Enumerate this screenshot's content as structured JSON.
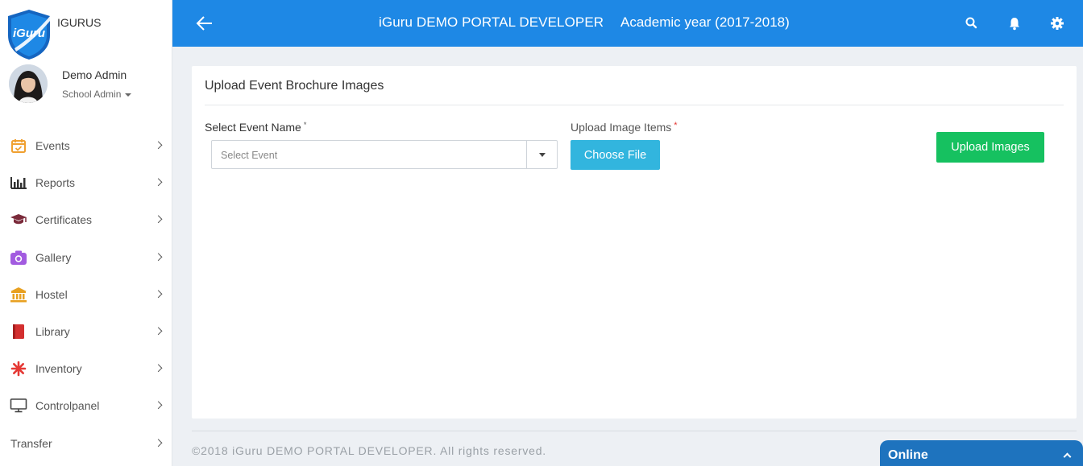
{
  "brand": {
    "name": "IGURUS",
    "logo_text": "iGuru"
  },
  "user": {
    "name": "Demo Admin",
    "role": "School Admin"
  },
  "nav": [
    {
      "label": "Events",
      "icon": "calendar-check-icon",
      "color": "#f0a030"
    },
    {
      "label": "Reports",
      "icon": "bar-chart-icon",
      "color": "#333333"
    },
    {
      "label": "Certificates",
      "icon": "graduation-cap-icon",
      "color": "#7a2a3a"
    },
    {
      "label": "Gallery",
      "icon": "camera-icon",
      "color": "#a25be0"
    },
    {
      "label": "Hostel",
      "icon": "building-icon",
      "color": "#e8a020"
    },
    {
      "label": "Library",
      "icon": "book-icon",
      "color": "#d32f2f"
    },
    {
      "label": "Inventory",
      "icon": "asterisk-icon",
      "color": "#e53935"
    },
    {
      "label": "Controlpanel",
      "icon": "monitor-icon",
      "color": "#444444"
    },
    {
      "label": "Transfer",
      "icon": "",
      "color": ""
    }
  ],
  "header": {
    "title": "iGuru DEMO PORTAL DEVELOPER",
    "academic_year": "Academic year (2017-2018)",
    "color": "#1e88e5"
  },
  "card": {
    "title": "Upload Event Brochure Images",
    "event_label": "Select Event Name",
    "event_placeholder": "Select Event",
    "upload_label": "Upload Image Items",
    "required_mark": "*",
    "choose_file_label": "Choose File",
    "upload_button_label": "Upload Images"
  },
  "footer": {
    "text": "©2018 iGuru DEMO PORTAL DEVELOPER. All rights reserved."
  },
  "chat": {
    "status": "Online"
  }
}
